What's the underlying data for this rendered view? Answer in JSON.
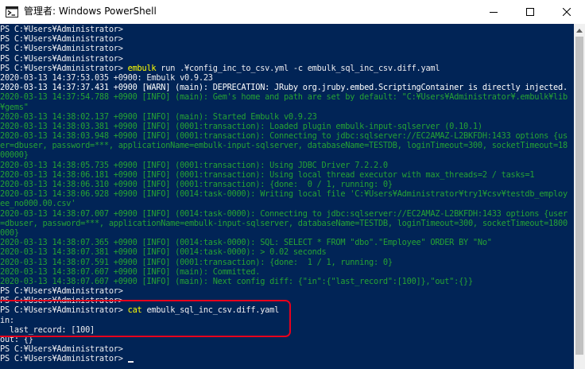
{
  "window": {
    "title": "管理者: Windows PowerShell"
  },
  "colors": {
    "console_background": "#012456",
    "prompt_text": "#eeedf0",
    "command_name": "#ffff00",
    "info_text": "#26a234",
    "highlight_border": "#e8001c"
  },
  "icons": {
    "app": "powershell-icon",
    "minimize": "minimize-icon",
    "maximize": "maximize-icon",
    "close": "close-icon",
    "scroll_up": "scroll-up-arrow-icon"
  },
  "console": {
    "lines": [
      {
        "type": "prompt",
        "text": "PS C:¥Users¥Administrator>"
      },
      {
        "type": "prompt",
        "text": "PS C:¥Users¥Administrator>"
      },
      {
        "type": "prompt",
        "text": "PS C:¥Users¥Administrator>"
      },
      {
        "type": "prompt",
        "text": "PS C:¥Users¥Administrator>"
      },
      {
        "type": "command",
        "prompt": "PS C:¥Users¥Administrator> ",
        "command": "embulk",
        "args": " run .¥config_inc_to_csv.yml -c embulk_sql_inc_csv.diff.yaml"
      },
      {
        "type": "out",
        "text": "2020-03-13 14:37:53.035 +0900: Embulk v0.9.23"
      },
      {
        "type": "warn",
        "text": "2020-03-13 14:37:37.431 +0900 [WARN] (main): DEPRECATION: JRuby org.jruby.embed.ScriptingContainer is directly injected."
      },
      {
        "type": "info",
        "text": "2020-03-13 14:37:54.788 +0900 [INFO] (main): Gem's home and path are set by default: \"C:¥Users¥Administrator¥.embulk¥lib"
      },
      {
        "type": "info",
        "text": "¥gems\""
      },
      {
        "type": "info",
        "text": "2020-03-13 14:38:02.137 +0900 [INFO] (main): Started Embulk v0.9.23"
      },
      {
        "type": "info",
        "text": "2020-03-13 14:38:03.381 +0900 [INFO] (0001:transaction): Loaded plugin embulk-input-sqlserver (0.10.1)"
      },
      {
        "type": "info",
        "text": "2020-03-13 14:38:03.948 +0900 [INFO] (0001:transaction): Connecting to jdbc:sqlserver://EC2AMAZ-L2BKFDH:1433 options {us"
      },
      {
        "type": "info",
        "text": "er=dbuser, password=***, applicationName=embulk-input-sqlserver, databaseName=TESTDB, loginTimeout=300, socketTimeout=18"
      },
      {
        "type": "info",
        "text": "00000}"
      },
      {
        "type": "info",
        "text": "2020-03-13 14:38:05.735 +0900 [INFO] (0001:transaction): Using JDBC Driver 7.2.2.0"
      },
      {
        "type": "info",
        "text": "2020-03-13 14:38:06.181 +0900 [INFO] (0001:transaction): Using local thread executor with max_threads=2 / tasks=1"
      },
      {
        "type": "info",
        "text": "2020-03-13 14:38:06.310 +0900 [INFO] (0001:transaction): {done:  0 / 1, running: 0}"
      },
      {
        "type": "info",
        "text": "2020-03-13 14:38:06.928 +0900 [INFO] (0014:task-0000): Writing local file 'C:¥Users¥Administrator¥try1¥csv¥testdb_employ"
      },
      {
        "type": "info",
        "text": "ee_no000.00.csv'"
      },
      {
        "type": "info",
        "text": "2020-03-13 14:38:07.007 +0900 [INFO] (0014:task-0000): Connecting to jdbc:sqlserver://EC2AMAZ-L2BKFDH:1433 options {user"
      },
      {
        "type": "info",
        "text": "=dbuser, password=***, applicationName=embulk-input-sqlserver, databaseName=TESTDB, loginTimeout=300, socketTimeout=1800"
      },
      {
        "type": "info",
        "text": "000}"
      },
      {
        "type": "info",
        "text": "2020-03-13 14:38:07.365 +0900 [INFO] (0014:task-0000): SQL: SELECT * FROM \"dbo\".\"Employee\" ORDER BY \"No\""
      },
      {
        "type": "info",
        "text": "2020-03-13 14:38:07.381 +0900 [INFO] (0014:task-0000): > 0.02 seconds"
      },
      {
        "type": "info",
        "text": "2020-03-13 14:38:07.591 +0900 [INFO] (0001:transaction): {done:  1 / 1, running: 0}"
      },
      {
        "type": "info",
        "text": "2020-03-13 14:38:07.607 +0900 [INFO] (main): Committed."
      },
      {
        "type": "info",
        "text": "2020-03-13 14:38:07.607 +0900 [INFO] (main): Next config diff: {\"in\":{\"last_record\":[100]},\"out\":{}}"
      },
      {
        "type": "prompt",
        "text": "PS C:¥Users¥Administrator>"
      },
      {
        "type": "prompt",
        "text": "PS C:¥Users¥Administrator>"
      },
      {
        "type": "command",
        "prompt": "PS C:¥Users¥Administrator> ",
        "command": "cat",
        "args": " embulk_sql_inc_csv.diff.yaml"
      },
      {
        "type": "out",
        "text": "in:"
      },
      {
        "type": "out",
        "text": "  last_record: [100]"
      },
      {
        "type": "out",
        "text": "out: {}"
      },
      {
        "type": "prompt",
        "text": "PS C:¥Users¥Administrator>"
      },
      {
        "type": "prompt-cursor",
        "text": "PS C:¥Users¥Administrator> "
      }
    ]
  }
}
